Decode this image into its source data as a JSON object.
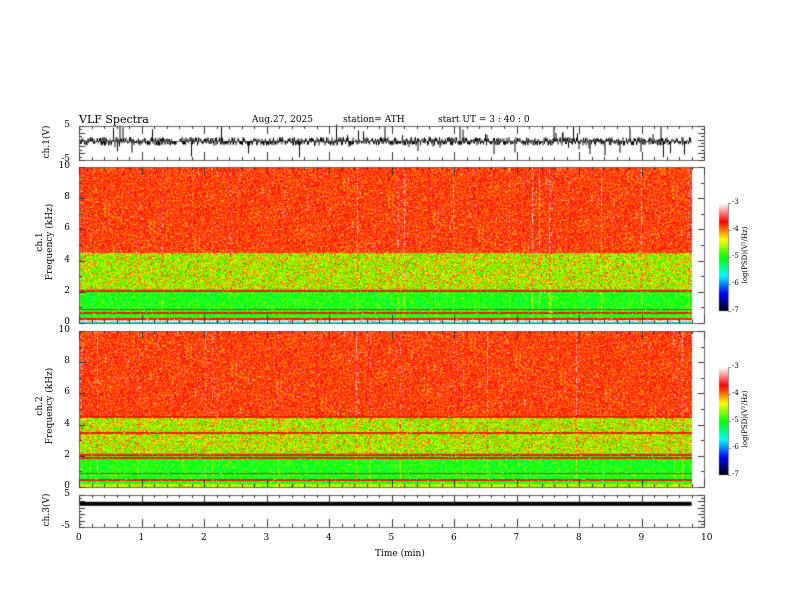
{
  "header": {
    "title": "VLF  Spectra",
    "date": "Aug.27, 2025",
    "station": "station= ATH",
    "start": "start  UT  =    3  : 40 : 0"
  },
  "chart_data": [
    {
      "type": "line",
      "ylabel": "ch.1(V)",
      "ylim": [
        -5,
        5
      ],
      "yticks": [
        "5",
        "-5"
      ],
      "xlim": [
        0,
        10
      ],
      "data_xrange": [
        0,
        9.8
      ],
      "description_values": {
        "baseline": 0,
        "noise_amplitude": 5
      }
    },
    {
      "type": "heatmap",
      "ylabel": "ch.1\nFrequency  (kHz)",
      "ylabel_line1": "ch.1",
      "ylabel_line2": "Frequency  (kHz)",
      "ylim": [
        0,
        10
      ],
      "yticks": [
        "0",
        "2",
        "4",
        "6",
        "8",
        "10"
      ],
      "xlim": [
        0,
        10
      ],
      "colorbar": {
        "label": "log(PSD)(V²/Hz)",
        "range": [
          -7,
          -3
        ],
        "ticks": [
          "-3",
          "-4",
          "-5",
          "-6",
          "-7"
        ]
      },
      "bands_khz": {
        "high_red": [
          4.5,
          10
        ],
        "mid_green": [
          2.2,
          4.5
        ],
        "low_cyan": [
          0.2,
          2.2
        ],
        "lines_khz": [
          2.1,
          0.9,
          0.7,
          0.3
        ]
      }
    },
    {
      "type": "heatmap",
      "ylabel_line1": "ch.2",
      "ylabel_line2": "Frequency  (kHz)",
      "ylim": [
        0,
        10
      ],
      "yticks": [
        "0",
        "2",
        "4",
        "6",
        "8",
        "10"
      ],
      "xlim": [
        0,
        10
      ],
      "colorbar": {
        "label": "log(PSD)(V²/Hz)",
        "range": [
          -7,
          -3
        ],
        "ticks": [
          "-3",
          "-4",
          "-5",
          "-6",
          "-7"
        ]
      },
      "bands_khz": {
        "high_red": [
          4.5,
          10
        ],
        "mid_green": [
          2.2,
          4.5
        ],
        "low_cyan": [
          0.2,
          2.2
        ],
        "lines_khz": [
          4.5,
          3.5,
          2.1,
          1.9,
          0.9,
          0.5
        ]
      }
    },
    {
      "type": "line",
      "ylabel": "ch.3(V)",
      "ylim": [
        -5,
        5
      ],
      "yticks": [
        "5",
        "-5"
      ],
      "xlim": [
        0,
        10
      ],
      "xlabel": "Time  (min)",
      "xticks": [
        "0",
        "1",
        "2",
        "3",
        "4",
        "5",
        "6",
        "7",
        "8",
        "9",
        "10"
      ],
      "data_xrange": [
        0,
        9.8
      ],
      "description_values": {
        "baseline": 0,
        "noise_amplitude": 0.3
      }
    }
  ],
  "colors": {
    "colormap": [
      "#000000",
      "#0000ff",
      "#00ffff",
      "#00ff00",
      "#ffff00",
      "#ff0000",
      "#ffffff"
    ],
    "trace": "#000000"
  }
}
